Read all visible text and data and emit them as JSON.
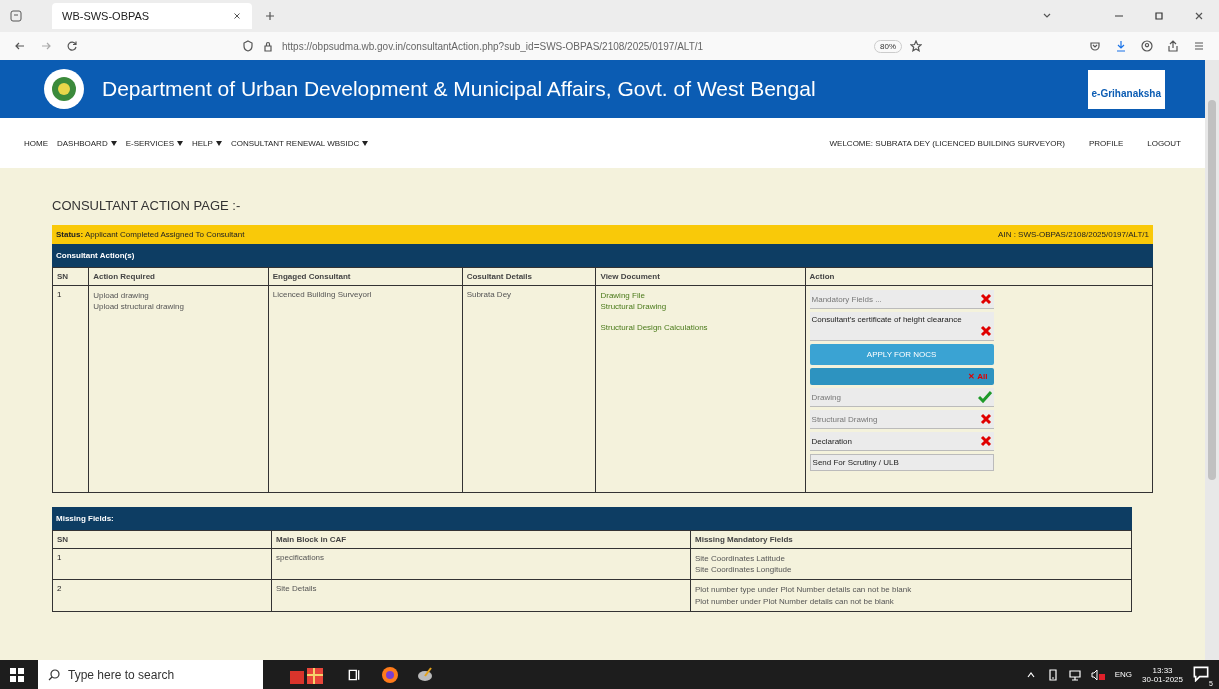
{
  "browser": {
    "tab_title": "WB-SWS-OBPAS",
    "url": "https://obpsudma.wb.gov.in/consultantAction.php?sub_id=SWS-OBPAS/2108/2025/0197/ALT/1",
    "zoom": "80%"
  },
  "header": {
    "title": "Department of Urban Development & Municipal Affairs, Govt. of West Bengal",
    "logo_text": "e-Grihanaksha"
  },
  "nav": {
    "items": [
      {
        "label": "HOME",
        "dropdown": false
      },
      {
        "label": "DASHBOARD",
        "dropdown": true
      },
      {
        "label": "E-SERVICES",
        "dropdown": true
      },
      {
        "label": "HELP",
        "dropdown": true
      },
      {
        "label": "CONSULTANT RENEWAL WBSIDC",
        "dropdown": true
      }
    ],
    "welcome": "WELCOME: SUBRATA DEY (LICENCED BUILDING SURVEYOR)",
    "links": [
      "PROFILE",
      "LOGOUT"
    ]
  },
  "page_title": "CONSULTANT ACTION PAGE :-",
  "status": {
    "label": "Status:",
    "text": "Applicant Completed Assigned To Consultant",
    "ain": "AIN : SWS-OBPAS/2108/2025/0197/ALT/1"
  },
  "actions_table": {
    "title": "Consultant Action(s)",
    "columns": [
      "SN",
      "Action Required",
      "Engaged Consultant",
      "Cosultant Details",
      "View Document",
      "Action"
    ],
    "rows": [
      {
        "sn": "1",
        "action_required": [
          "Upload drawing",
          "Upload structural drawing"
        ],
        "engaged": "Licenced Building Surveyorl",
        "details": "Subrata Dey",
        "document_groups": [
          [
            "Drawing File",
            "Structural Drawing"
          ],
          [
            "Structural Design Calculations"
          ]
        ],
        "actions": [
          {
            "kind": "status",
            "label": "Mandatory Fields ...",
            "done": false,
            "muted": true
          },
          {
            "kind": "status",
            "label": "Consultant's certificate of height clearance",
            "done": false,
            "muted": false
          },
          {
            "kind": "button",
            "label": "APPLY FOR NOCS"
          },
          {
            "kind": "bar",
            "label": "✕ All"
          },
          {
            "kind": "status",
            "label": "Drawing",
            "done": true,
            "muted": true
          },
          {
            "kind": "status",
            "label": "Structural Drawing",
            "done": false,
            "muted": true
          },
          {
            "kind": "status",
            "label": "Declaration",
            "done": false,
            "muted": false
          },
          {
            "kind": "plain",
            "label": "Send For Scrutiny / ULB"
          }
        ]
      }
    ]
  },
  "missing_table": {
    "title": "Missing Fields:",
    "columns": [
      "SN",
      "Main Block in CAF",
      "Missing Mandatory Fields"
    ],
    "rows": [
      {
        "sn": "1",
        "block": "specifications",
        "fields": [
          "Site Coordinates Latitude",
          "Site Coordinates Longitude"
        ]
      },
      {
        "sn": "2",
        "block": "Site Details",
        "fields": [
          "Plot number type under Plot Number details can not be blank",
          "Plot number under Plot Number details can not be blank"
        ]
      }
    ]
  },
  "taskbar": {
    "search_placeholder": "Type here to search",
    "language": "ENG",
    "time": "13:33",
    "date": "30-01-2025",
    "notifications": "5"
  }
}
